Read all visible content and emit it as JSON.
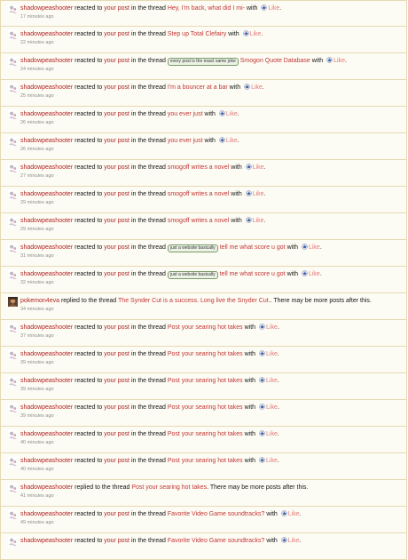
{
  "alerts": [
    {
      "user": "shadowpeashooter",
      "action": "reacted to",
      "target": "your post",
      "mid": "in the thread",
      "prefix": "",
      "thread": "Hey, I'm back, what did I mi-",
      "with": "with",
      "reaction": "Like",
      "time": "17 minutes ago",
      "avatar": "default"
    },
    {
      "user": "shadowpeashooter",
      "action": "reacted to",
      "target": "your post",
      "mid": "in the thread",
      "prefix": "",
      "thread": "Step up Total Clefairy",
      "with": "with",
      "reaction": "Like",
      "time": "22 minutes ago",
      "avatar": "default"
    },
    {
      "user": "shadowpeashooter",
      "action": "reacted to",
      "target": "your post",
      "mid": "in the thread",
      "prefix": "every post is the exact same joke",
      "thread": "Smogon Quote Database",
      "with": "with",
      "reaction": "Like",
      "time": "24 minutes ago",
      "avatar": "default"
    },
    {
      "user": "shadowpeashooter",
      "action": "reacted to",
      "target": "your post",
      "mid": "in the thread",
      "prefix": "",
      "thread": "I'm a bouncer at a bar",
      "with": "with",
      "reaction": "Like",
      "time": "25 minutes ago",
      "avatar": "default"
    },
    {
      "user": "shadowpeashooter",
      "action": "reacted to",
      "target": "your post",
      "mid": "in the thread",
      "prefix": "",
      "thread": "you ever just",
      "with": "with",
      "reaction": "Like",
      "time": "26 minutes ago",
      "avatar": "default"
    },
    {
      "user": "shadowpeashooter",
      "action": "reacted to",
      "target": "your post",
      "mid": "in the thread",
      "prefix": "",
      "thread": "you ever just",
      "with": "with",
      "reaction": "Like",
      "time": "26 minutes ago",
      "avatar": "default"
    },
    {
      "user": "shadowpeashooter",
      "action": "reacted to",
      "target": "your post",
      "mid": "in the thread",
      "prefix": "",
      "thread": "smogoff writes a novel",
      "with": "with",
      "reaction": "Like",
      "time": "27 minutes ago",
      "avatar": "default"
    },
    {
      "user": "shadowpeashooter",
      "action": "reacted to",
      "target": "your post",
      "mid": "in the thread",
      "prefix": "",
      "thread": "smogoff writes a novel",
      "with": "with",
      "reaction": "Like",
      "time": "29 minutes ago",
      "avatar": "default"
    },
    {
      "user": "shadowpeashooter",
      "action": "reacted to",
      "target": "your post",
      "mid": "in the thread",
      "prefix": "",
      "thread": "smogoff writes a novel",
      "with": "with",
      "reaction": "Like",
      "time": "29 minutes ago",
      "avatar": "default"
    },
    {
      "user": "shadowpeashooter",
      "action": "reacted to",
      "target": "your post",
      "mid": "in the thread",
      "prefix": "just a website basically",
      "thread": "tell me what score u got",
      "with": "with",
      "reaction": "Like",
      "time": "31 minutes ago",
      "avatar": "default"
    },
    {
      "user": "shadowpeashooter",
      "action": "reacted to",
      "target": "your post",
      "mid": "in the thread",
      "prefix": "just a website basically",
      "thread": "tell me what score u got",
      "with": "with",
      "reaction": "Like",
      "time": "32 minutes ago",
      "avatar": "default"
    },
    {
      "user": "pokemon4eva",
      "action": "replied to the thread",
      "target": "",
      "mid": "",
      "prefix": "",
      "thread": "The Synder Cut is a success. Long live the Snyder Cut.",
      "with": ". There may be more posts after this.",
      "reaction": "",
      "time": "34 minutes ago",
      "avatar": "custom"
    },
    {
      "user": "shadowpeashooter",
      "action": "reacted to",
      "target": "your post",
      "mid": "in the thread",
      "prefix": "",
      "thread": "Post your searing hot takes",
      "with": "with",
      "reaction": "Like",
      "time": "37 minutes ago",
      "avatar": "default"
    },
    {
      "user": "shadowpeashooter",
      "action": "reacted to",
      "target": "your post",
      "mid": "in the thread",
      "prefix": "",
      "thread": "Post your searing hot takes",
      "with": "with",
      "reaction": "Like",
      "time": "39 minutes ago",
      "avatar": "default"
    },
    {
      "user": "shadowpeashooter",
      "action": "reacted to",
      "target": "your post",
      "mid": "in the thread",
      "prefix": "",
      "thread": "Post your searing hot takes",
      "with": "with",
      "reaction": "Like",
      "time": "39 minutes ago",
      "avatar": "default"
    },
    {
      "user": "shadowpeashooter",
      "action": "reacted to",
      "target": "your post",
      "mid": "in the thread",
      "prefix": "",
      "thread": "Post your searing hot takes",
      "with": "with",
      "reaction": "Like",
      "time": "39 minutes ago",
      "avatar": "default"
    },
    {
      "user": "shadowpeashooter",
      "action": "reacted to",
      "target": "your post",
      "mid": "in the thread",
      "prefix": "",
      "thread": "Post your searing hot takes",
      "with": "with",
      "reaction": "Like",
      "time": "40 minutes ago",
      "avatar": "default"
    },
    {
      "user": "shadowpeashooter",
      "action": "reacted to",
      "target": "your post",
      "mid": "in the thread",
      "prefix": "",
      "thread": "Post your searing hot takes",
      "with": "with",
      "reaction": "Like",
      "time": "40 minutes ago",
      "avatar": "default"
    },
    {
      "user": "shadowpeashooter",
      "action": "replied to the thread",
      "target": "",
      "mid": "",
      "prefix": "",
      "thread": "Post your searing hot takes",
      "with": ". There may be more posts after this.",
      "reaction": "",
      "time": "41 minutes ago",
      "avatar": "default"
    },
    {
      "user": "shadowpeashooter",
      "action": "reacted to",
      "target": "your post",
      "mid": "in the thread",
      "prefix": "",
      "thread": "Favorite Video Game soundtracks?",
      "with": "with",
      "reaction": "Like",
      "time": "49 minutes ago",
      "avatar": "default"
    },
    {
      "user": "shadowpeashooter",
      "action": "reacted to",
      "target": "your post",
      "mid": "in the thread",
      "prefix": "",
      "thread": "Favorite Video Game soundtracks?",
      "with": "with",
      "reaction": "Like",
      "time": "",
      "avatar": "default"
    }
  ],
  "icons": {
    "like": "like-reaction-icon",
    "avatar_default": "default-avatar-icon",
    "avatar_custom": "user-avatar-icon"
  },
  "colors": {
    "link": "#ad1f1f",
    "like": "#e07878",
    "border": "#e6d9b4",
    "row_bg": "#fdfcf4"
  }
}
